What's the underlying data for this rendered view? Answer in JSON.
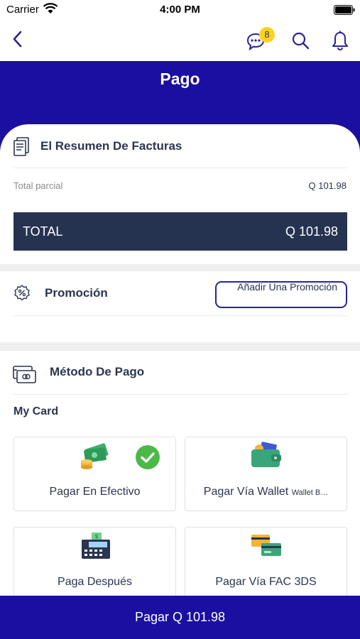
{
  "status_bar": {
    "carrier": "Carrier",
    "time": "4:00 PM"
  },
  "nav": {
    "chat_badge": "8",
    "icons": [
      "back-icon",
      "chat-icon",
      "search-icon",
      "bell-icon"
    ]
  },
  "header": {
    "title": "Pago"
  },
  "summary": {
    "title": "El Resumen De Facturas",
    "subtotal_label": "Total parcial",
    "subtotal_value": "Q 101.98",
    "total_label": "TOTAL",
    "total_value": "Q 101.98"
  },
  "promotion": {
    "title": "Promoción",
    "button_label": "Añadir Una Promoción"
  },
  "payment": {
    "title": "Método De Pago",
    "my_card_label": "My Card",
    "options": [
      {
        "label": "Pagar En Efectivo",
        "selected": true,
        "icon": "cash-icon"
      },
      {
        "label": "Pagar Vía Wallet",
        "suffix": "Wallet B…",
        "selected": false,
        "icon": "wallet-icon"
      },
      {
        "label": "Paga Después",
        "selected": false,
        "icon": "register-icon"
      },
      {
        "label": "Pagar Vía FAC 3DS",
        "selected": false,
        "icon": "cards-icon"
      }
    ]
  },
  "footer": {
    "pay_button": "Pagar Q 101.98"
  },
  "colors": {
    "brand": "#1a0fa0",
    "total_bar": "#253351",
    "badge": "#ffd21f",
    "check": "#4cb848"
  }
}
